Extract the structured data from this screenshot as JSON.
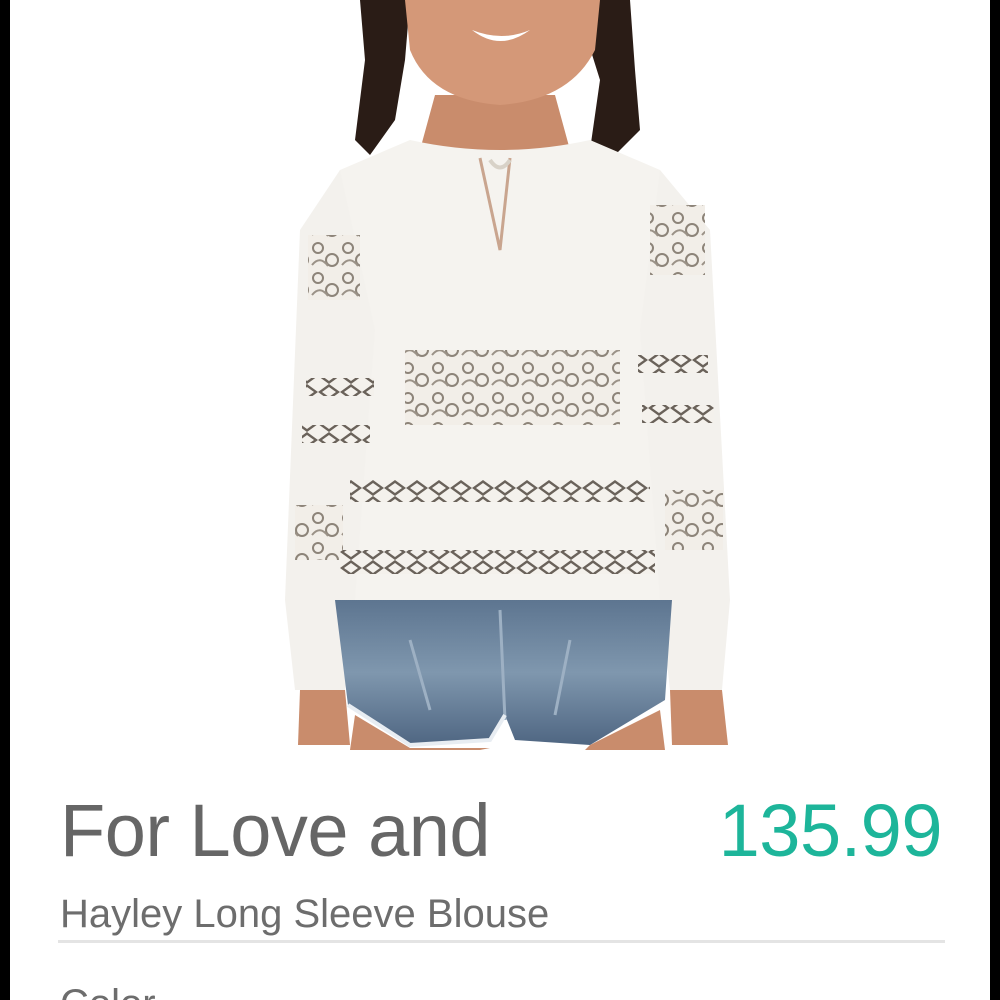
{
  "product": {
    "brand_title": "For Love and",
    "price": "135.99",
    "name": "Hayley Long Sleeve Blouse",
    "color_label": "Color"
  },
  "theme": {
    "price_color": "#1db59a",
    "text_color": "#666666"
  }
}
